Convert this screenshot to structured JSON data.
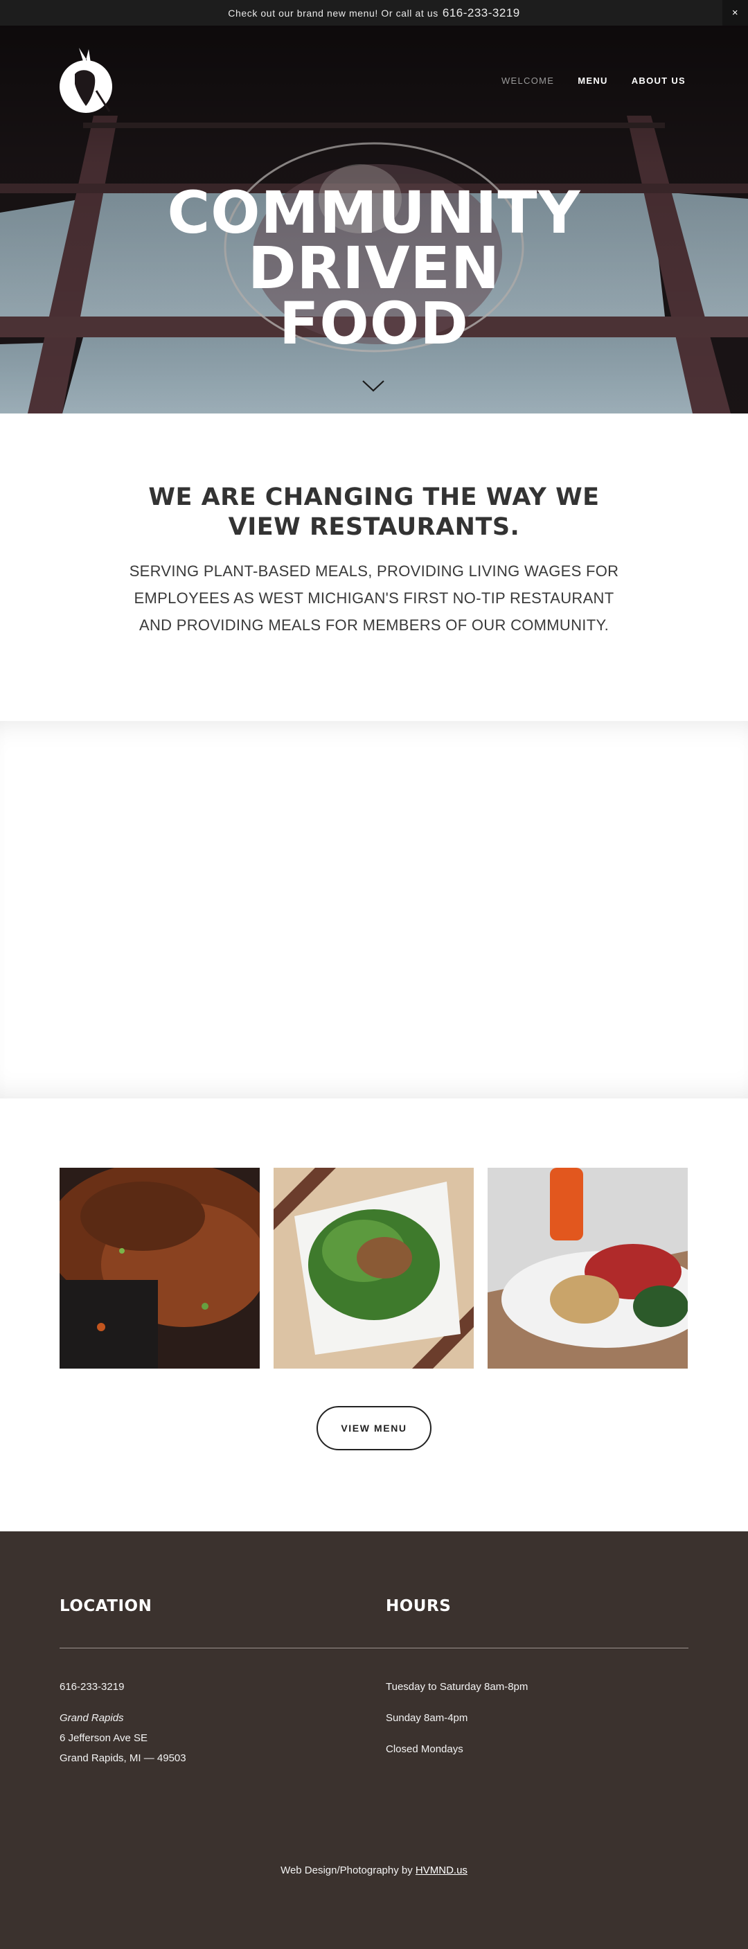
{
  "announcement": {
    "text": "Check out our brand new menu! Or call at us",
    "phone": "616-233-3219",
    "close_label": "×"
  },
  "nav": {
    "items": [
      {
        "label": "WELCOME"
      },
      {
        "label": "MENU"
      },
      {
        "label": "ABOUT US"
      }
    ]
  },
  "hero": {
    "title_lines": [
      "COMMUNITY",
      "DRIVEN",
      "FOOD"
    ]
  },
  "intro": {
    "heading": "WE ARE CHANGING THE WAY WE VIEW RESTAURANTS.",
    "body": "SERVING PLANT-BASED MEALS, PROVIDING LIVING WAGES FOR EMPLOYEES AS WEST MICHIGAN'S FIRST NO-TIP RESTAURANT AND PROVIDING MEALS FOR MEMBERS OF OUR COMMUNITY."
  },
  "gallery": {
    "button_label": "VIEW MENU"
  },
  "footer": {
    "location_heading": "LOCATION",
    "hours_heading": "HOURS",
    "phone": "616-233-3219",
    "city_italic": "Grand Rapids",
    "street": "6 Jefferson Ave SE",
    "city_zip": "Grand Rapids, MI — 49503",
    "hours": [
      "Tuesday to Saturday 8am-8pm",
      "Sunday 8am-4pm",
      "Closed Mondays"
    ],
    "credit_text": "Web Design/Photography by",
    "credit_link": "HVMND.us"
  },
  "colors": {
    "announce_bg": "#1d1d1d",
    "footer_bg": "#3b322e",
    "text_dark": "#333333"
  }
}
